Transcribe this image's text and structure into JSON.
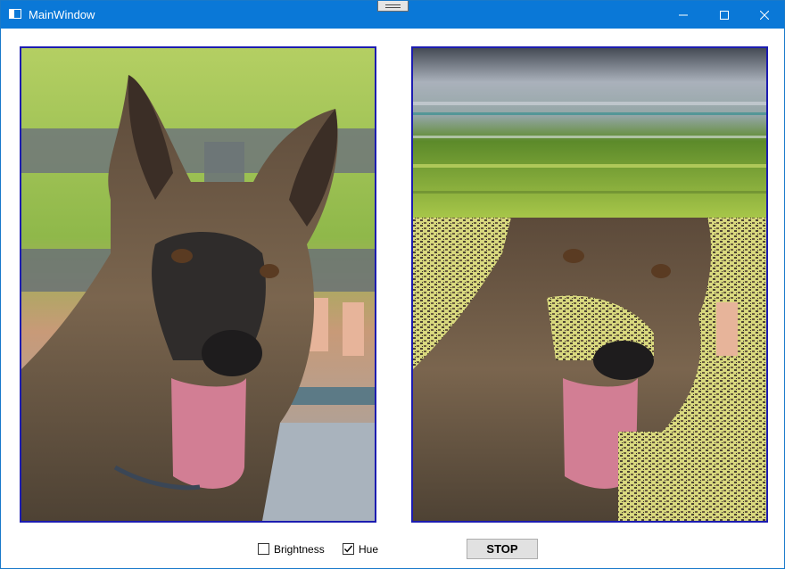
{
  "window": {
    "title": "MainWindow"
  },
  "caption": {
    "minimize": "minimize-icon",
    "maximize": "maximize-icon",
    "close": "close-icon"
  },
  "images": {
    "original": "dog-photo-original",
    "processed": "dog-photo-processed"
  },
  "controls": {
    "brightness_label": "Brightness",
    "brightness_checked": false,
    "hue_label": "Hue",
    "hue_checked": true,
    "stop_label": "STOP"
  },
  "colors": {
    "titlebar": "#0a78d7",
    "border": "#1c1cb0",
    "artifact": "#d8d87e"
  }
}
